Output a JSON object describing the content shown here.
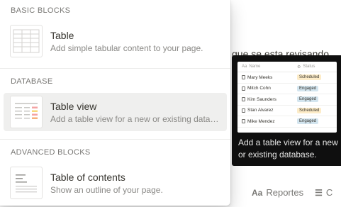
{
  "background": {
    "text": "que se esta revisando",
    "toolbar": [
      {
        "label": "Reportes",
        "icon": "font-icon"
      },
      {
        "label": "C",
        "icon": "list-icon"
      }
    ]
  },
  "menu": {
    "sections": [
      {
        "label": "BASIC BLOCKS",
        "items": [
          {
            "title": "Table",
            "description": "Add simple tabular content to your page.",
            "icon": "table-icon"
          }
        ]
      },
      {
        "label": "DATABASE",
        "items": [
          {
            "title": "Table view",
            "description": "Add a table view for a new or existing data…",
            "icon": "table-view-icon"
          }
        ]
      },
      {
        "label": "ADVANCED BLOCKS",
        "items": [
          {
            "title": "Table of contents",
            "description": "Show an outline of your page.",
            "icon": "table-of-contents-icon"
          }
        ]
      }
    ]
  },
  "preview": {
    "columns": [
      "Name",
      "Status"
    ],
    "rows": [
      {
        "name": "Mary Meeks",
        "status": "Scheduled"
      },
      {
        "name": "Mitch Cohn",
        "status": "Engaged"
      },
      {
        "name": "Kim Saunders",
        "status": "Engaged"
      },
      {
        "name": "Stan Alvarez",
        "status": "Scheduled"
      },
      {
        "name": "Mike Mendez",
        "status": "Engaged"
      }
    ],
    "caption": "Add a table view for a new or existing database.",
    "colors": {
      "scheduled_bg": "#fdecc8",
      "engaged_bg": "#d3e5ef"
    }
  }
}
